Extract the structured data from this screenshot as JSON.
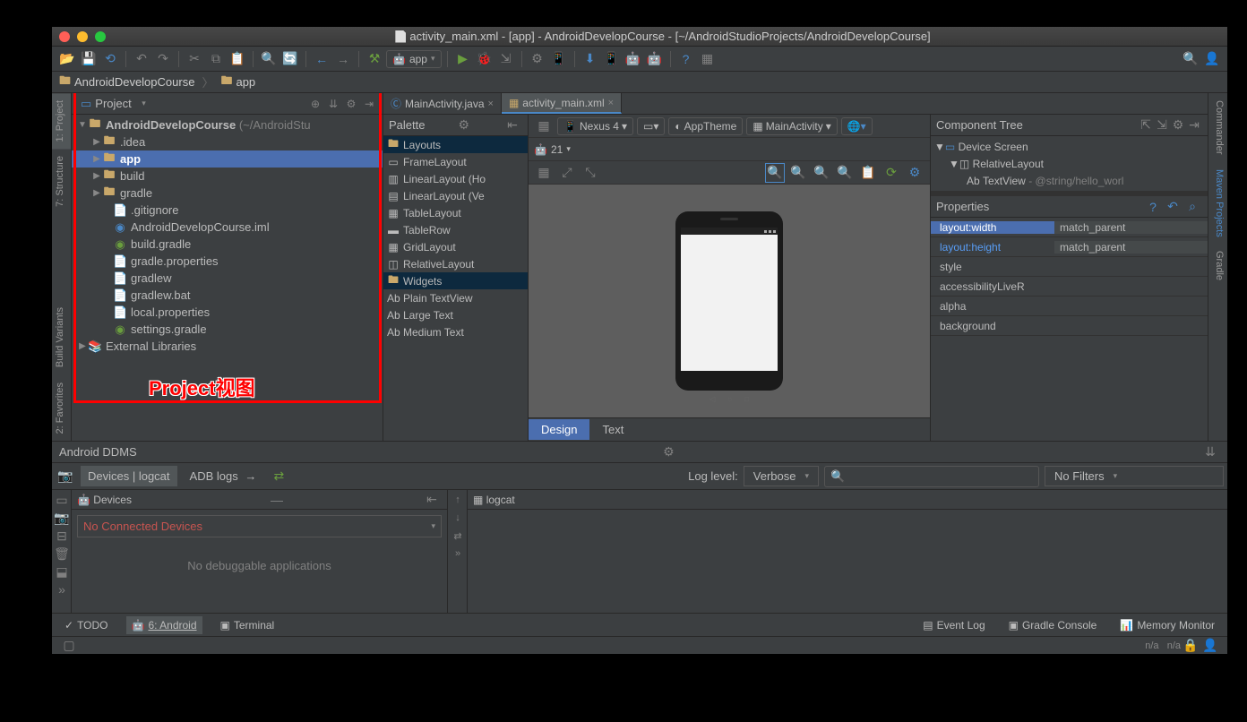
{
  "title": "activity_main.xml - [app] - AndroidDevelopCourse - [~/AndroidStudioProjects/AndroidDevelopCourse]",
  "breadcrumb": {
    "p0": "AndroidDevelopCourse",
    "p1": "app"
  },
  "runConfig": "app",
  "projectPanel": {
    "label": "Project",
    "annotationLabel": "Project视图",
    "tree": {
      "root": "AndroidDevelopCourse",
      "rootHint": "(~/AndroidStu",
      "items": {
        "idea": ".idea",
        "app": "app",
        "build": "build",
        "gradle": "gradle",
        "gitignore": ".gitignore",
        "iml": "AndroidDevelopCourse.iml",
        "buildgradle": "build.gradle",
        "gradleprops": "gradle.properties",
        "gradlew": "gradlew",
        "gradlewbat": "gradlew.bat",
        "localprops": "local.properties",
        "settings": "settings.gradle",
        "extlib": "External Libraries"
      }
    }
  },
  "leftTabs": {
    "project": "1: Project",
    "structure": "7: Structure",
    "buildv": "Build Variants",
    "fav": "2: Favorites"
  },
  "rightTabs": {
    "cmd": "Commander",
    "maven": "Maven Projects",
    "gradle": "Gradle"
  },
  "editorTabs": {
    "t0": "MainActivity.java",
    "t1": "activity_main.xml"
  },
  "palette": {
    "title": "Palette",
    "cats": {
      "layouts": "Layouts",
      "widgets": "Widgets"
    },
    "layouts": {
      "frame": "FrameLayout",
      "linH": "LinearLayout (Ho",
      "linV": "LinearLayout (Ve",
      "table": "TableLayout",
      "tablerow": "TableRow",
      "grid": "GridLayout",
      "rel": "RelativeLayout"
    },
    "widgets": {
      "plain": "Plain TextView",
      "large": "Large Text",
      "medium": "Medium Text"
    }
  },
  "designer": {
    "device": "Nexus 4",
    "theme": "AppTheme",
    "activity": "MainActivity",
    "api": "21",
    "tabs": {
      "design": "Design",
      "text": "Text"
    }
  },
  "componentTree": {
    "title": "Component Tree",
    "root": "Device Screen",
    "rel": "RelativeLayout",
    "tv": "TextView",
    "tvhint": "- @string/hello_worl"
  },
  "properties": {
    "title": "Properties",
    "rows": {
      "r0k": "layout:width",
      "r0v": "match_parent",
      "r1k": "layout:height",
      "r1v": "match_parent",
      "r2k": "style",
      "r2v": "",
      "r3k": "accessibilityLiveR",
      "r3v": "",
      "r4k": "alpha",
      "r4v": "",
      "r5k": "background",
      "r5v": ""
    }
  },
  "ddms": {
    "title": "Android DDMS",
    "tabs": {
      "dev": "Devices | logcat",
      "adb": "ADB logs"
    },
    "loglevelLabel": "Log level:",
    "loglevel": "Verbose",
    "filter": "No Filters",
    "devicesTitle": "Devices",
    "logcatTitle": "logcat",
    "noDev": "No Connected Devices",
    "noApps": "No debuggable applications"
  },
  "bottom": {
    "todo": "TODO",
    "android": "6: Android",
    "terminal": "Terminal",
    "eventlog": "Event Log",
    "gradlec": "Gradle Console",
    "memmon": "Memory Monitor"
  },
  "status": {
    "na1": "n/a",
    "na2": "n/a"
  }
}
